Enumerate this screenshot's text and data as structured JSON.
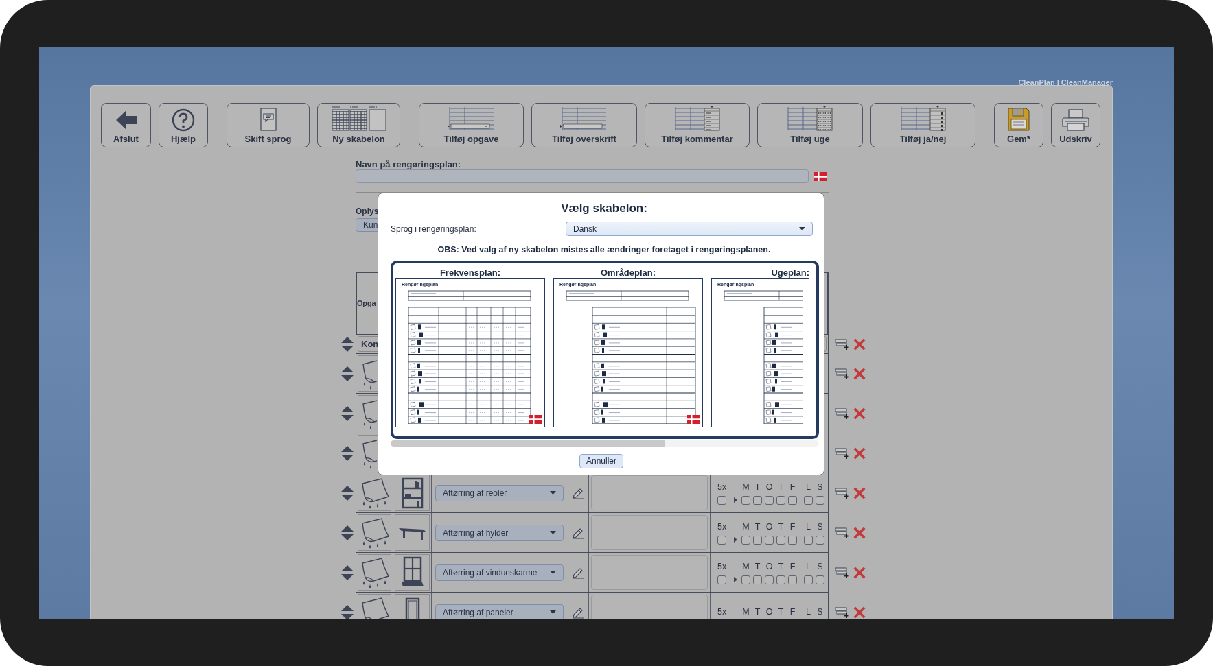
{
  "app_title": "CleanPlan | CleanManager",
  "toolbar": [
    [
      {
        "label": "Afslut",
        "kind": "back"
      },
      {
        "label": "Hjælp",
        "kind": "help"
      }
    ],
    [
      {
        "label": "Skift sprog",
        "kind": "language"
      },
      {
        "label": "Ny skabelon",
        "kind": "template"
      }
    ],
    [
      {
        "label": "Tilføj opgave",
        "kind": "task"
      },
      {
        "label": "Tilføj overskrift",
        "kind": "heading"
      },
      {
        "label": "Tilføj kommentar",
        "kind": "comment"
      },
      {
        "label": "Tilføj uge",
        "kind": "week"
      },
      {
        "label": "Tilføj ja/nej",
        "kind": "yesno"
      }
    ],
    [
      {
        "label": "Gem*",
        "kind": "save"
      },
      {
        "label": "Udskriv",
        "kind": "print"
      }
    ]
  ],
  "plan_name": {
    "label": "Navn på rengøringsplan:"
  },
  "info": {
    "label": "Oplys",
    "dropdown": "Kun"
  },
  "table": {
    "header": "Opga",
    "section": "Kon",
    "rows": [
      {
        "kind": "covered"
      },
      {
        "kind": "covered"
      },
      {
        "kind": "covered"
      },
      {
        "kind": "bookshelf",
        "task": "Aftørring af reoler",
        "frequency": {
          "label": "5x",
          "checked": false
        },
        "days": [
          {
            "label": "M",
            "checked": false
          },
          {
            "label": "T",
            "checked": false
          },
          {
            "label": "O",
            "checked": false
          },
          {
            "label": "T",
            "checked": false
          },
          {
            "label": "F",
            "checked": false
          },
          {
            "label": "L",
            "checked": false
          },
          {
            "label": "S",
            "checked": false
          }
        ]
      },
      {
        "kind": "shelf",
        "task": "Aftørring af hylder",
        "frequency": {
          "label": "5x",
          "checked": false
        },
        "days": [
          {
            "label": "M",
            "checked": false
          },
          {
            "label": "T",
            "checked": false
          },
          {
            "label": "O",
            "checked": false
          },
          {
            "label": "T",
            "checked": false
          },
          {
            "label": "F",
            "checked": false
          },
          {
            "label": "L",
            "checked": false
          },
          {
            "label": "S",
            "checked": false
          }
        ]
      },
      {
        "kind": "window",
        "task": "Aftørring af vindueskarme",
        "frequency": {
          "label": "5x",
          "checked": false
        },
        "days": [
          {
            "label": "M",
            "checked": false
          },
          {
            "label": "T",
            "checked": false
          },
          {
            "label": "O",
            "checked": false
          },
          {
            "label": "T",
            "checked": false
          },
          {
            "label": "F",
            "checked": false
          },
          {
            "label": "L",
            "checked": false
          },
          {
            "label": "S",
            "checked": false
          }
        ]
      },
      {
        "kind": "door",
        "task": "Aftørring af paneler",
        "frequency": {
          "label": "5x"
        },
        "days": [
          {
            "label": "M"
          },
          {
            "label": "T"
          },
          {
            "label": "O"
          },
          {
            "label": "T"
          },
          {
            "label": "F"
          },
          {
            "label": "L"
          },
          {
            "label": "S"
          }
        ]
      }
    ]
  },
  "modal": {
    "title": "Vælg skabelon:",
    "language_label": "Sprog i rengøringsplan:",
    "language": "Dansk",
    "warning": "OBS: Ved valg af ny skabelon mistes alle ændringer foretaget i rengøringsplanen.",
    "templates": [
      {
        "label": "Frekvensplan:",
        "doc_title": "Rengøringsplan",
        "kind": "frequency",
        "flag": true
      },
      {
        "label": "Områdeplan:",
        "doc_title": "Rengøringsplan",
        "kind": "area",
        "flag": true
      },
      {
        "label": "Ugeplan:",
        "doc_title": "Rengøringsplan",
        "kind": "week",
        "flag": false
      }
    ],
    "cancel": "Annuller"
  }
}
